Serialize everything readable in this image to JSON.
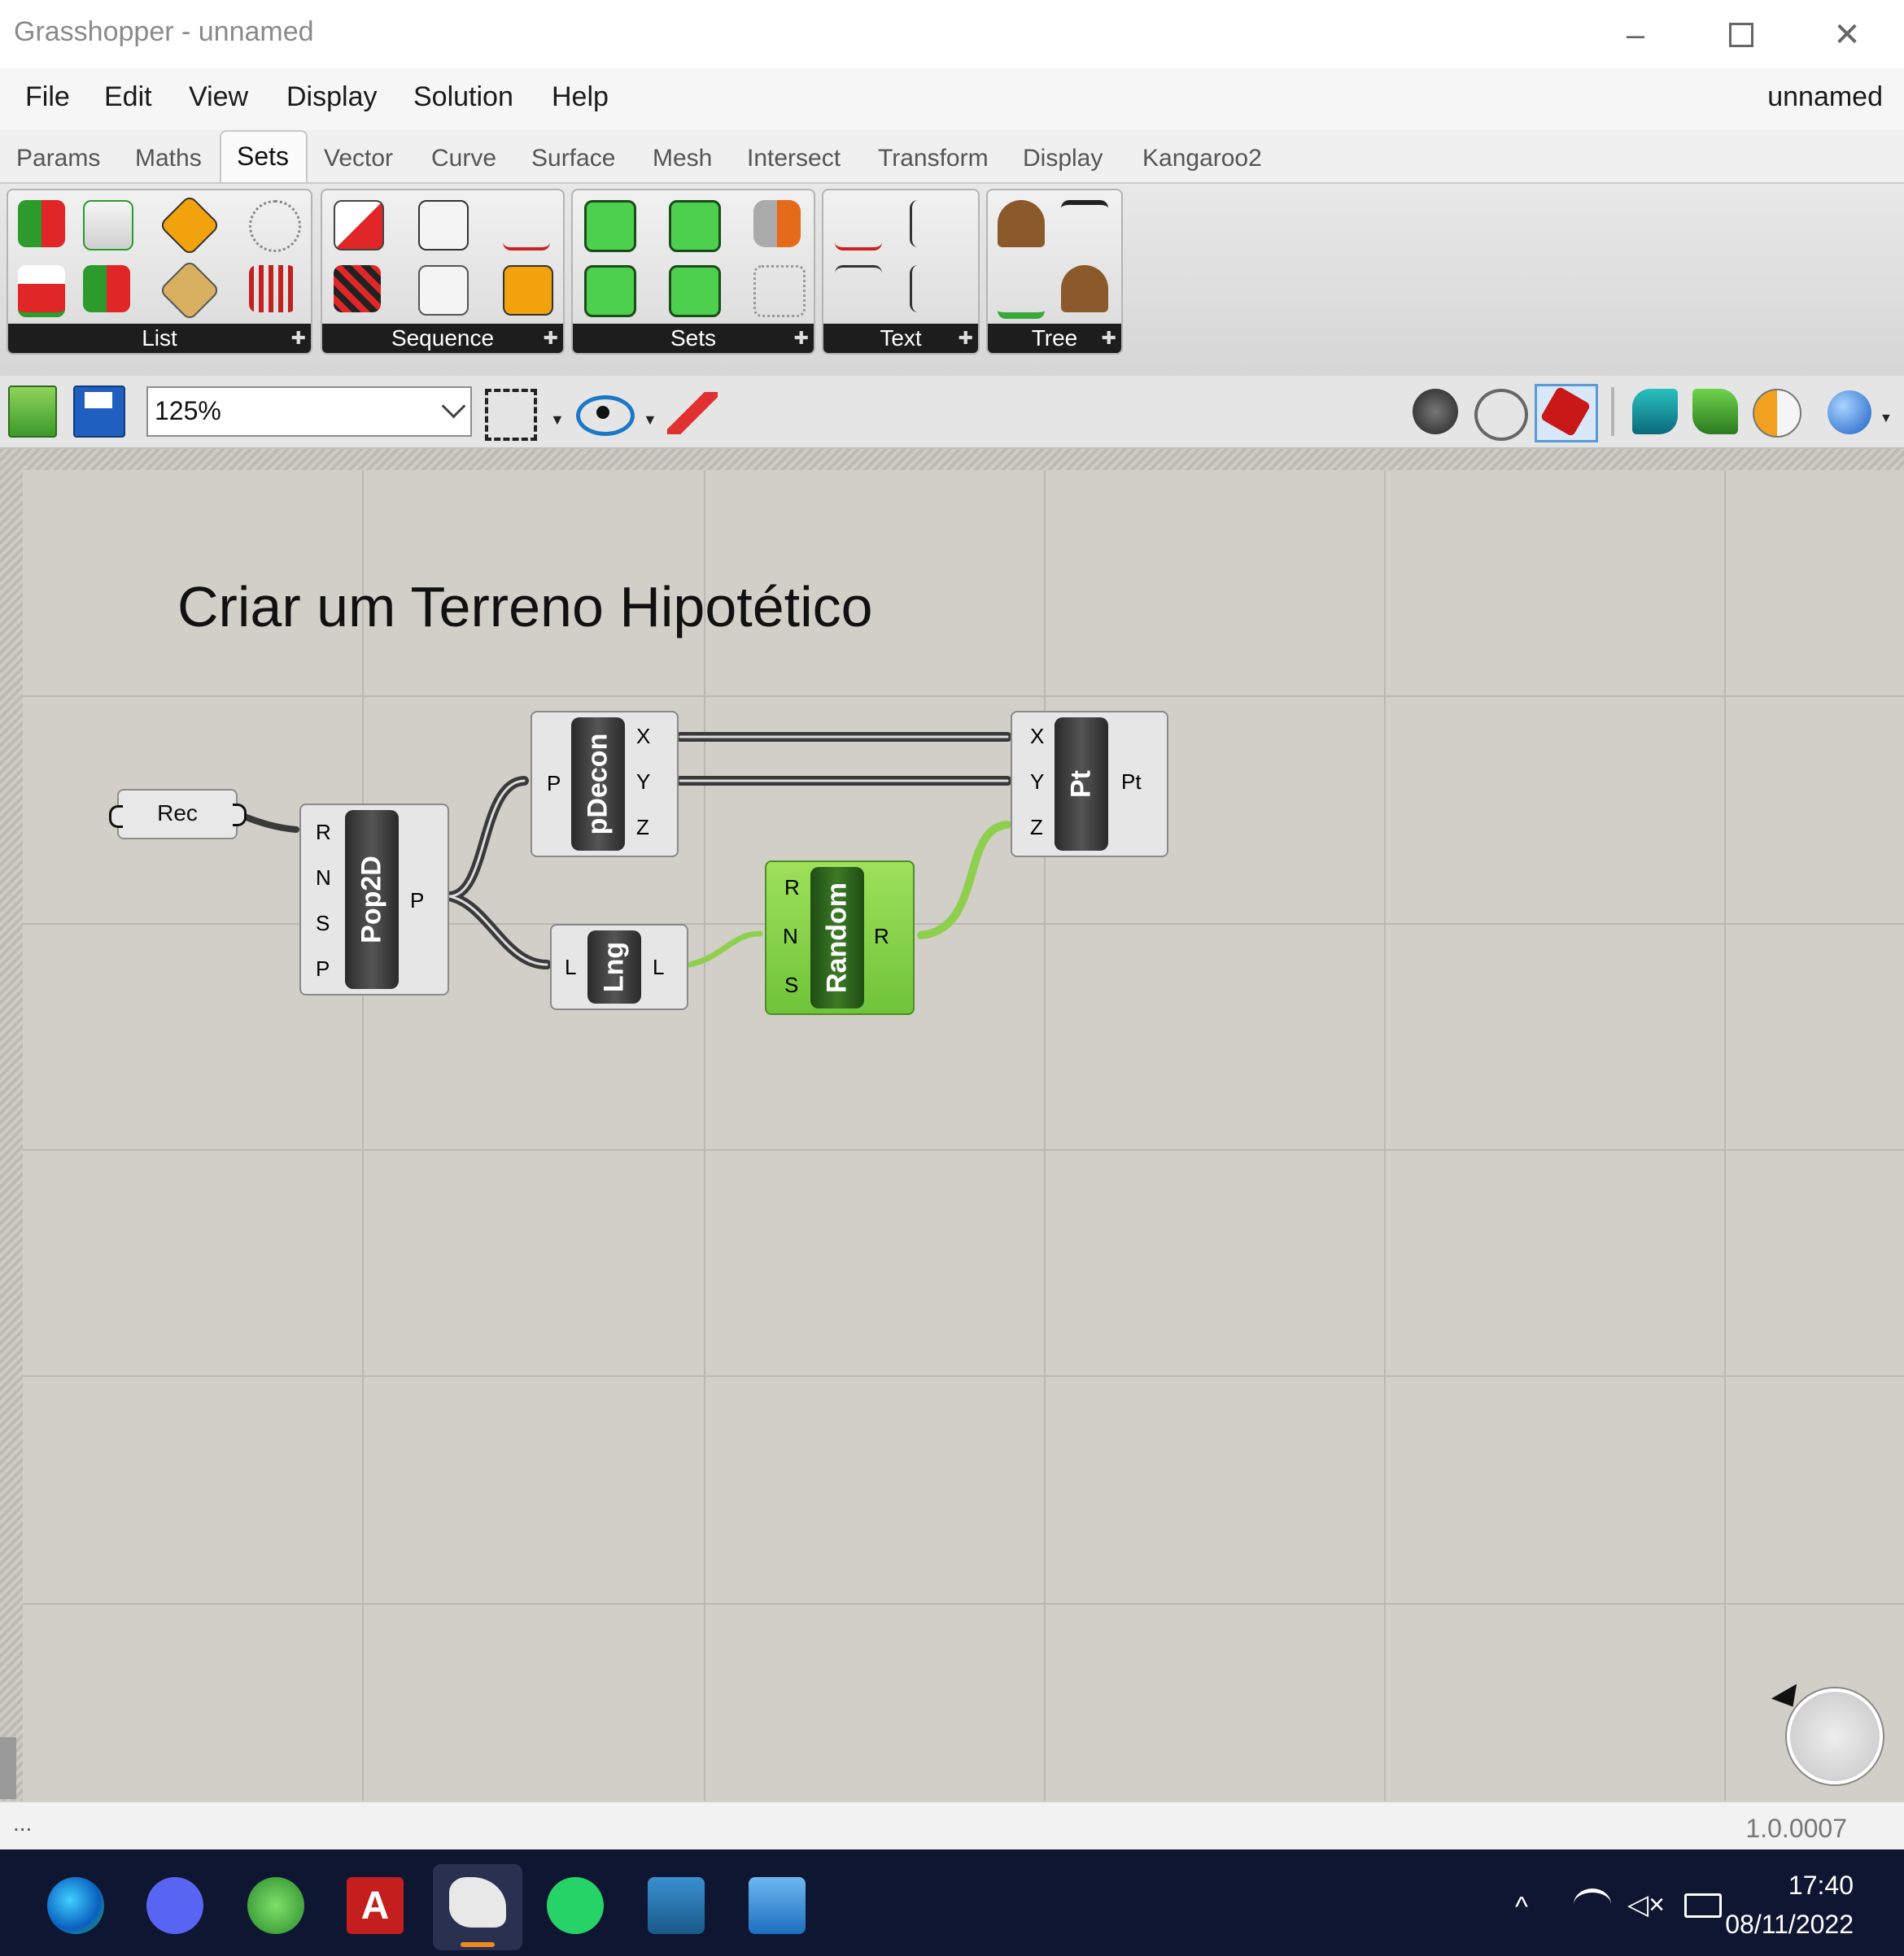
{
  "window": {
    "title": "Grasshopper - unnamed"
  },
  "menu": {
    "items": [
      "File",
      "Edit",
      "View",
      "Display",
      "Solution",
      "Help"
    ],
    "document_name": "unnamed"
  },
  "tabs": [
    "Params",
    "Maths",
    "Sets",
    "Vector",
    "Curve",
    "Surface",
    "Mesh",
    "Intersect",
    "Transform",
    "Display",
    "Kangaroo2"
  ],
  "active_tab": "Sets",
  "ribbon_panels": [
    "List",
    "Sequence",
    "Sets",
    "Text",
    "Tree"
  ],
  "toolbar": {
    "zoom": "125%"
  },
  "canvas": {
    "title": "Criar um Terreno Hipotético",
    "components": {
      "rec": {
        "label": "Rec"
      },
      "pop2d": {
        "name": "Pop2D",
        "inputs": [
          "R",
          "N",
          "S",
          "P"
        ],
        "outputs": [
          "P"
        ]
      },
      "pdecon": {
        "name": "pDecon",
        "inputs": [
          "P"
        ],
        "outputs": [
          "X",
          "Y",
          "Z"
        ]
      },
      "lng": {
        "name": "Lng",
        "inputs": [
          "L"
        ],
        "outputs": [
          "L"
        ]
      },
      "random": {
        "name": "Random",
        "inputs": [
          "R",
          "N",
          "S"
        ],
        "outputs": [
          "R"
        ]
      },
      "pt": {
        "name": "Pt",
        "inputs": [
          "X",
          "Y",
          "Z"
        ],
        "outputs": [
          "Pt"
        ]
      }
    }
  },
  "status": {
    "left": "...",
    "version": "1.0.0007"
  },
  "taskbar": {
    "time": "17:40",
    "date": "08/11/2022"
  },
  "colors": {
    "canvas": "#d2cec8",
    "component": "#e8e8e8",
    "random_green": "#8ad14a",
    "taskbar": "#0f1632"
  }
}
